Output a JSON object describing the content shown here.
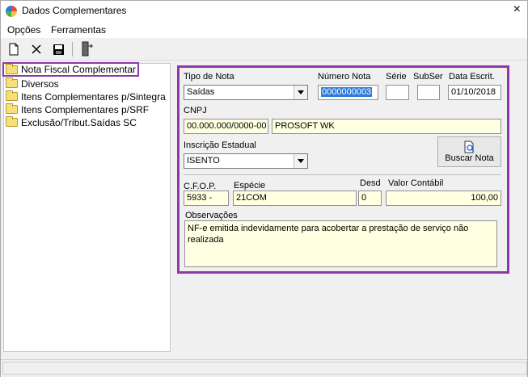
{
  "window": {
    "title": "Dados Complementares",
    "close_icon": "×"
  },
  "menu": {
    "items": [
      "Opções",
      "Ferramentas"
    ]
  },
  "toolbar": {
    "icons": [
      "new-document-icon",
      "delete-icon",
      "save-icon",
      "exit-icon"
    ]
  },
  "tree": {
    "items": [
      {
        "label": "Nota Fiscal Complementar",
        "selected": true
      },
      {
        "label": "Diversos"
      },
      {
        "label": "Itens Complementares p/Sintegra"
      },
      {
        "label": "Itens Complementares p/SRF"
      },
      {
        "label": "Exclusão/Tribut.Saídas SC"
      }
    ]
  },
  "form": {
    "tipo_nota": {
      "label": "Tipo de Nota",
      "value": "Saídas"
    },
    "numero_nota": {
      "label": "Número Nota",
      "value": "0000000003"
    },
    "serie": {
      "label": "Série",
      "value": ""
    },
    "subser": {
      "label": "SubSer",
      "value": ""
    },
    "data_escrit": {
      "label": "Data Escrit.",
      "value": "01/10/2018"
    },
    "cnpj": {
      "label": "CNPJ",
      "value": "00.000.000/0000-00",
      "name": "PROSOFT WK"
    },
    "inscricao": {
      "label": "Inscrição Estadual",
      "value": "ISENTO"
    },
    "buscar": {
      "label": "Buscar Nota"
    },
    "cfop": {
      "label": "C.F.O.P.",
      "value": "5933 -"
    },
    "especie": {
      "label": "Espécie",
      "value": "21COM"
    },
    "desd": {
      "label": "Desd",
      "value": "0"
    },
    "valor": {
      "label": "Valor Contábil",
      "value": "100,00"
    },
    "obs": {
      "label": "Observações",
      "value": "NF-e emitida indevidamente para acobertar a prestação de serviço não realizada"
    }
  },
  "colors": {
    "accent": "#8b3aa8",
    "highlight": "#2b7bd8",
    "readonly": "#ffffe1"
  }
}
